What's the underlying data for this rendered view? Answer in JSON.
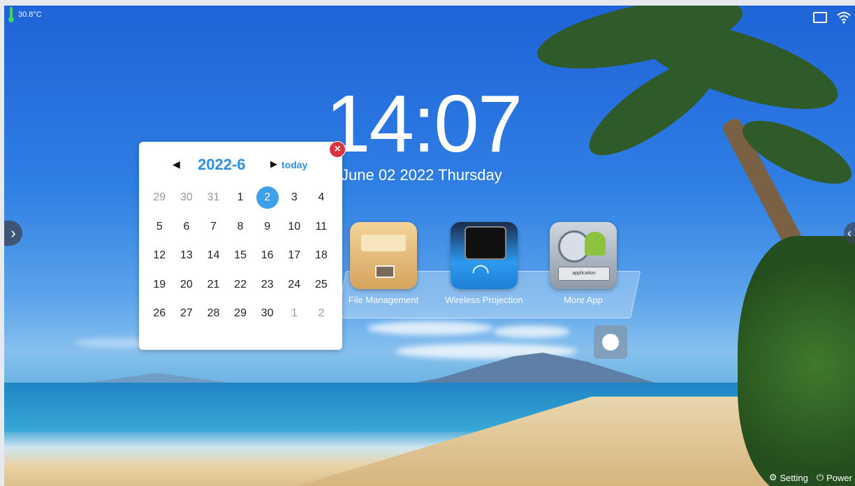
{
  "status": {
    "temperature": "30.8°C",
    "icons": [
      "thermometer-icon",
      "usb-icon",
      "wifi-icon"
    ]
  },
  "clock": {
    "time": "14:07",
    "date": "June 02 2022 Thursday"
  },
  "calendar": {
    "month": "2022-6",
    "prev_symbol": "◀",
    "next_symbol": "▶",
    "today_label": "today",
    "close_symbol": "×",
    "selected_day": "2",
    "weeks": [
      [
        "29",
        "30",
        "31",
        "1",
        "2",
        "3",
        "4"
      ],
      [
        "5",
        "6",
        "7",
        "8",
        "9",
        "10",
        "11"
      ],
      [
        "12",
        "13",
        "14",
        "15",
        "16",
        "17",
        "18"
      ],
      [
        "19",
        "20",
        "21",
        "22",
        "23",
        "24",
        "25"
      ],
      [
        "26",
        "27",
        "28",
        "29",
        "30",
        "1",
        "2"
      ]
    ],
    "accent_color": "#2f8ee0"
  },
  "apps": [
    {
      "label": "File Management",
      "icon": "file-cabinet-icon"
    },
    {
      "label": "Wireless Projection",
      "icon": "wireless-projection-icon"
    },
    {
      "label": "More App",
      "icon": "more-app-icon"
    }
  ],
  "bottom": {
    "setting_label": "Setting",
    "power_label": "Power"
  }
}
